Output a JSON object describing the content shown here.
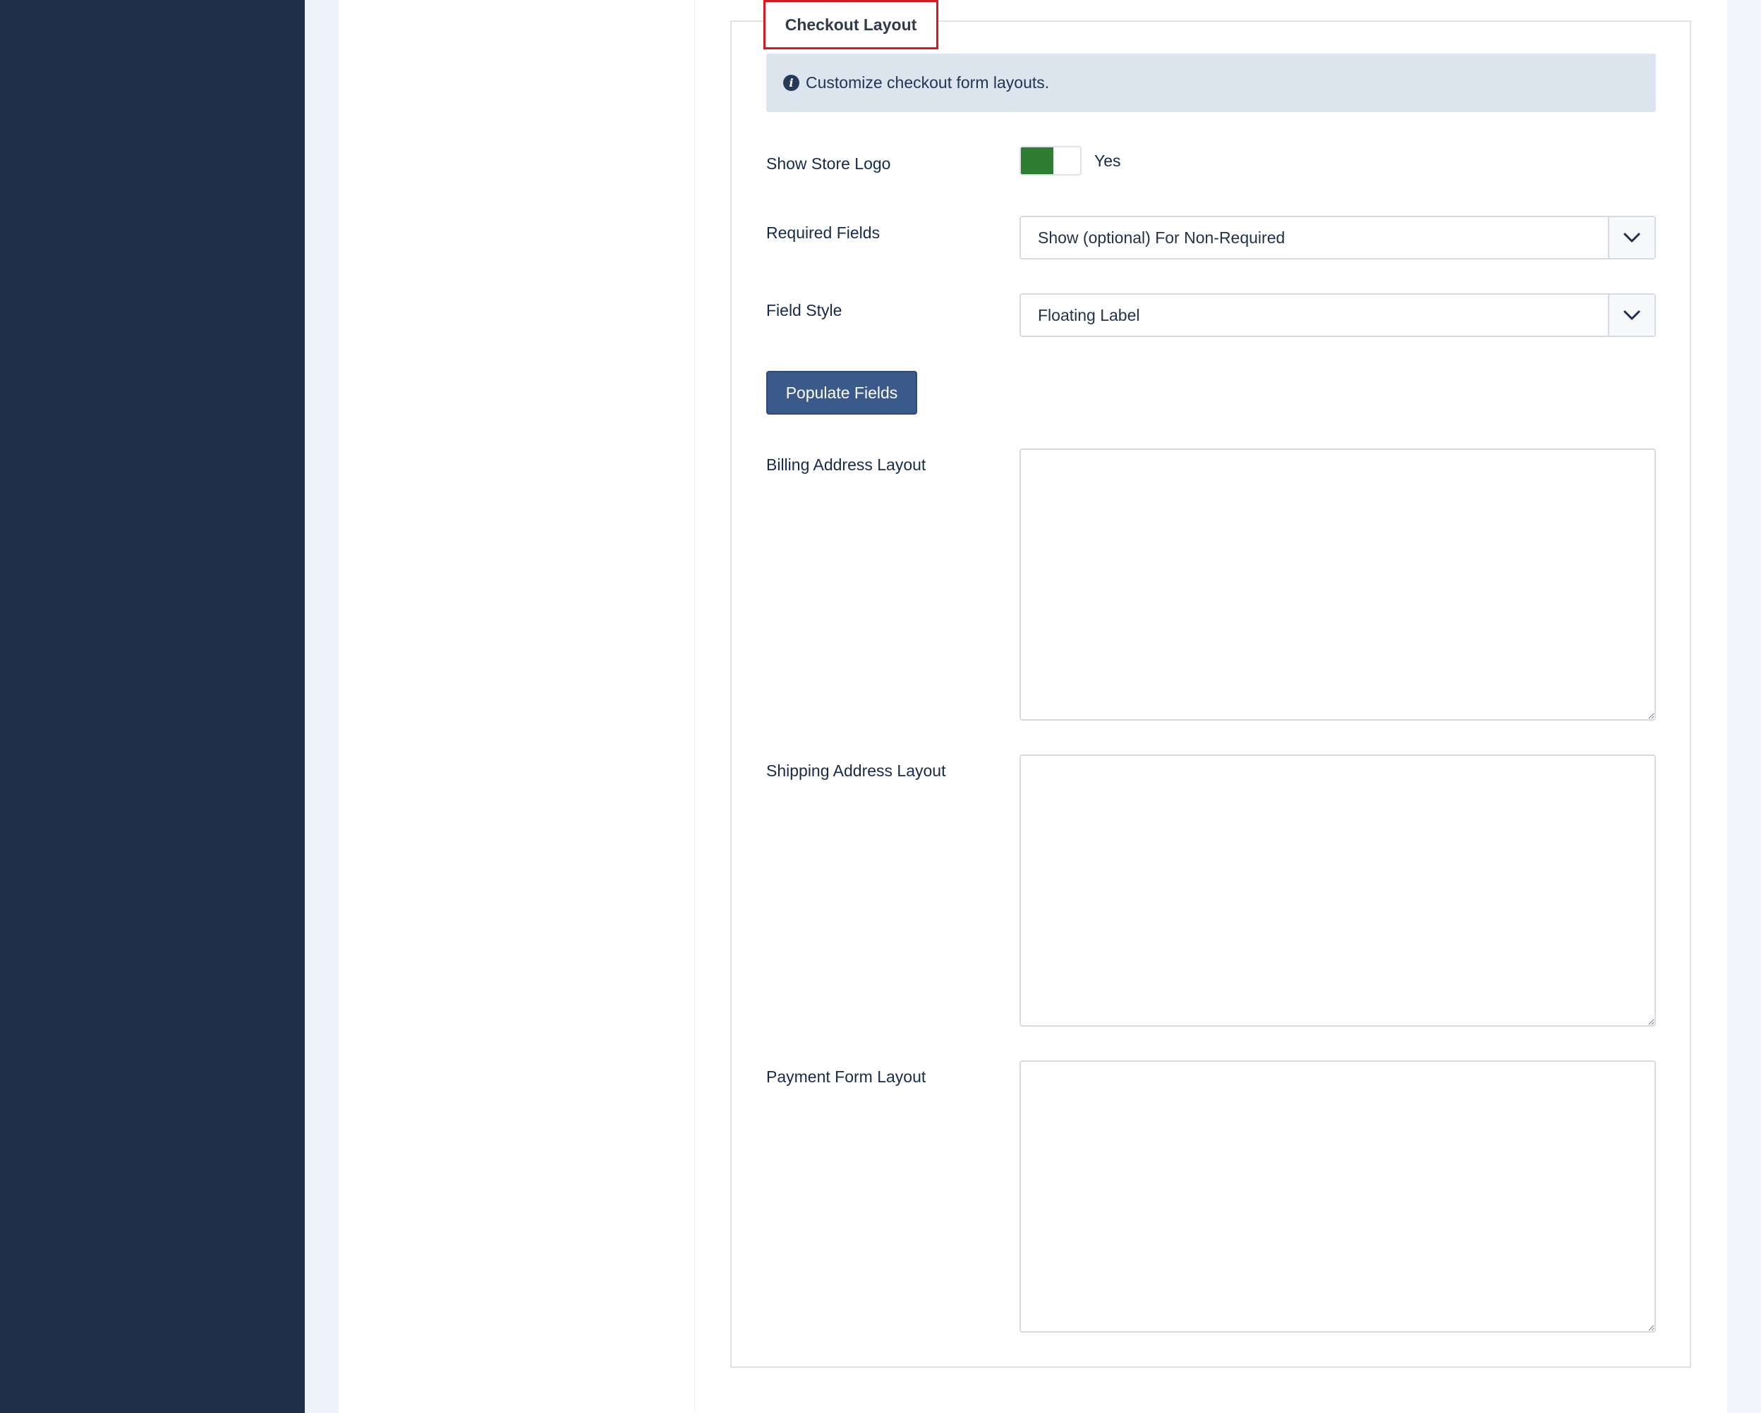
{
  "section": {
    "legend": "Checkout Layout",
    "info_text": "Customize checkout form layouts."
  },
  "fields": {
    "show_store_logo": {
      "label": "Show Store Logo",
      "toggle_state": "on",
      "toggle_text": "Yes"
    },
    "required_fields": {
      "label": "Required Fields",
      "value": "Show (optional) For Non-Required"
    },
    "field_style": {
      "label": "Field Style",
      "value": "Floating Label"
    },
    "billing_address_layout": {
      "label": "Billing Address Layout",
      "value": ""
    },
    "shipping_address_layout": {
      "label": "Shipping Address Layout",
      "value": ""
    },
    "payment_form_layout": {
      "label": "Payment Form Layout",
      "value": ""
    }
  },
  "actions": {
    "populate_fields_label": "Populate Fields"
  },
  "icons": {
    "info": "info-circle-icon",
    "select_arrow": "chevron-down-icon"
  },
  "colors": {
    "sidebar": "#1f2f4a",
    "toggle_on": "#2e7d32",
    "button": "#3a5a8c",
    "legend_highlight": "#e0141e",
    "info_background": "#dce4ee"
  }
}
